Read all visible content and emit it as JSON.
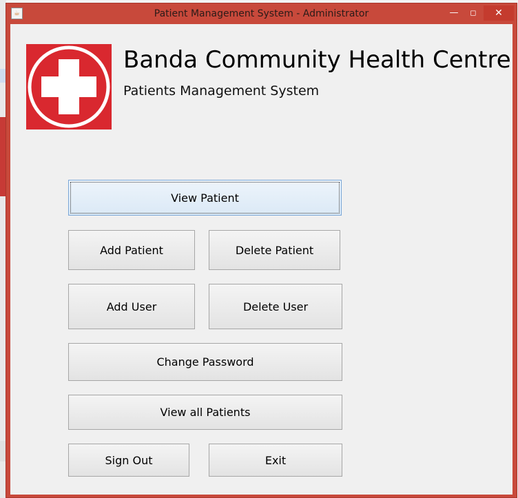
{
  "window": {
    "title": "Patient Management System - Administrator",
    "buttons": {
      "minimize": "—",
      "maximize": "◻",
      "close": "✕"
    }
  },
  "header": {
    "title": "Banda Community Health Centre",
    "subtitle": "Patients Management System",
    "logo_icon": "red-cross-icon"
  },
  "buttons": {
    "view_patient": "View Patient",
    "add_patient": "Add Patient",
    "delete_patient": "Delete Patient",
    "add_user": "Add User",
    "delete_user": "Delete User",
    "change_password": "Change Password",
    "view_all_patients": "View all Patients",
    "sign_out": "Sign Out",
    "exit": "Exit"
  },
  "colors": {
    "title_bar": "#c8493b",
    "logo_red": "#d9282f",
    "client_background": "#f0f0f0",
    "focus_button": "#dbe9f6"
  }
}
